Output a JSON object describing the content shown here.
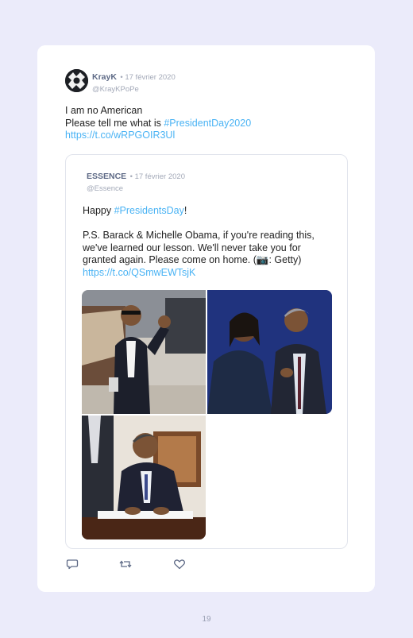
{
  "tweet": {
    "author_name": "KrayK",
    "date": "• 17 février 2020",
    "handle": "@KrayKPoPe",
    "line1": "I am no American",
    "line2_prefix": "Please tell me what is ",
    "hashtag": "#PresidentDay2020",
    "link": "https://t.co/wRPGOIR3Ul"
  },
  "quote": {
    "author_name": "ESSENCE",
    "date": "• 17 février 2020",
    "handle": "@Essence",
    "greeting_prefix": "Happy ",
    "hashtag": "#PresidentsDay",
    "greeting_suffix": "!",
    "body": "P.S. Barack & Michelle Obama, if you're reading this, we've learned our lesson. We'll never take you for granted again. Please come on home. (",
    "camera_icon_glyph": "📷",
    "credit": ": Getty)",
    "link": "https://t.co/QSmwEWTsjK",
    "photos": [
      "photo-obama-waving",
      "photo-michelle-and-barack",
      "photo-obama-signing"
    ]
  },
  "actions": {
    "icons": [
      "reply-icon",
      "retweet-icon",
      "like-icon"
    ]
  },
  "page_number": "19",
  "colors": {
    "background": "#ebebfa",
    "card": "#ffffff",
    "link": "#4ab3f4",
    "meta": "#a3a9b8",
    "name": "#5e6a86"
  }
}
